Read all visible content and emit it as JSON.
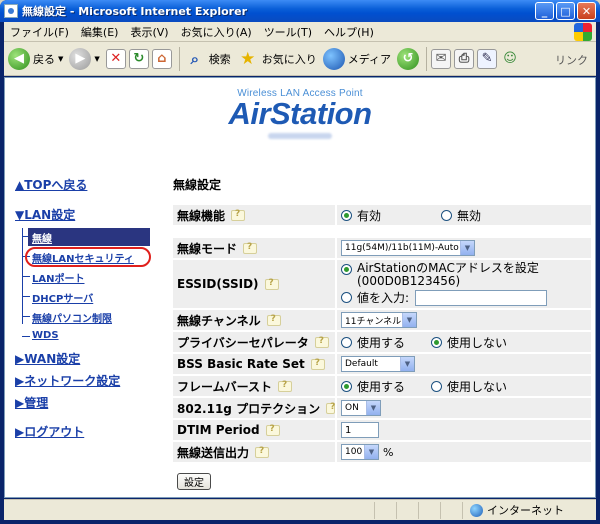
{
  "window": {
    "title": "無線設定 - Microsoft Internet Explorer"
  },
  "menubar": {
    "items": [
      "ファイル(F)",
      "編集(E)",
      "表示(V)",
      "お気に入り(A)",
      "ツール(T)",
      "ヘルプ(H)"
    ]
  },
  "toolbar": {
    "back": "戻る",
    "search": "検索",
    "favorites": "お気に入り",
    "media": "メディア",
    "links": "リンク"
  },
  "logo": {
    "subtitle": "Wireless LAN Access Point",
    "name": "AirStation"
  },
  "nav": {
    "top": "▲TOPへ戻る",
    "lan": "▼LAN設定",
    "lan_items": [
      "無線",
      "無線LANセキュリティ",
      "LANポート",
      "DHCPサーバ",
      "無線パソコン制限",
      "WDS"
    ],
    "wan": "▶WAN設定",
    "network": "▶ネットワーク設定",
    "admin": "▶管理",
    "logout": "▶ログアウト"
  },
  "page": {
    "heading": "無線設定"
  },
  "form": {
    "wireless_function": {
      "label": "無線機能",
      "opt1": "有効",
      "opt2": "無効",
      "selected": "有効"
    },
    "wireless_mode": {
      "label": "無線モード",
      "value": "11g(54M)/11b(11M)-Auto"
    },
    "essid": {
      "label": "ESSID(SSID)",
      "opt1": "AirStationのMACアドレスを設定",
      "opt1_detail": "(000D0B123456)",
      "opt2": "値を入力:",
      "input_value": ""
    },
    "channel": {
      "label": "無線チャンネル",
      "value": "11チャンネル"
    },
    "privacy_separator": {
      "label": "プライバシーセパレータ",
      "opt1": "使用する",
      "opt2": "使用しない",
      "selected": "使用しない"
    },
    "bss_rate": {
      "label": "BSS Basic Rate Set",
      "value": "Default"
    },
    "frame_burst": {
      "label": "フレームバースト",
      "opt1": "使用する",
      "opt2": "使用しない",
      "selected": "使用する"
    },
    "protection": {
      "label": "802.11g プロテクション",
      "value": "ON"
    },
    "dtim": {
      "label": "DTIM Period",
      "value": "1"
    },
    "tx_power": {
      "label": "無線送信出力",
      "value": "100",
      "unit": "%"
    },
    "submit": "設定"
  },
  "statusbar": {
    "zone": "インターネット"
  }
}
